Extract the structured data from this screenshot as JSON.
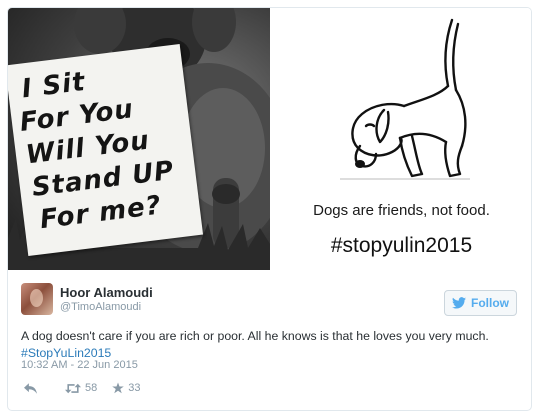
{
  "photo": {
    "sign_lines": [
      "I Sit",
      "For You",
      "Will You",
      "Stand UP",
      "For me?"
    ]
  },
  "poster": {
    "caption": "Dogs are friends, not food.",
    "hashtag": "#stopyulin2015"
  },
  "tweet": {
    "author_name": "Hoor Alamoudi",
    "author_handle": "@TimoAlamoudi",
    "follow_label": "Follow",
    "text_line1": "A dog doesn't care if you are rich or poor. All he knows is that he loves you very much.",
    "hashtag": "#StopYuLin2015",
    "timestamp": "10:32 AM - 22 Jun 2015",
    "retweet_count": "58",
    "favorite_count": "33"
  },
  "icons": {
    "follow": "bird-icon",
    "reply": "reply-icon",
    "retweet": "retweet-icon",
    "favorite": "star-icon"
  },
  "colors": {
    "link": "#2b7bb9",
    "follow_text": "#55acee",
    "muted": "#8899a6",
    "border": "#e1e8ed"
  }
}
